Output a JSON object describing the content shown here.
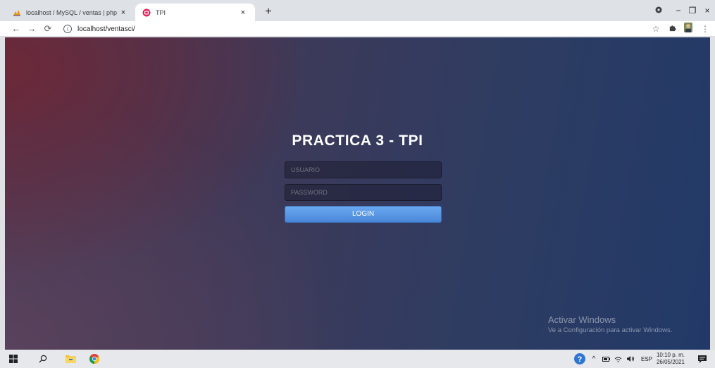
{
  "browser": {
    "tabs": [
      {
        "title": "localhost / MySQL / ventas | php",
        "active": false
      },
      {
        "title": "TPI",
        "active": true
      }
    ],
    "new_tab_label": "+",
    "close_glyph": "×",
    "url": "localhost/ventasci/",
    "window_controls": {
      "minimize": "−",
      "maximize": "❐",
      "close": "×"
    }
  },
  "page": {
    "title": "PRACTICA 3 - TPI",
    "username_placeholder": "USUARIO",
    "password_placeholder": "PASSWORD",
    "login_label": "LOGIN",
    "accent_color": "#4a86d8"
  },
  "watermark": {
    "line1": "Activar Windows",
    "line2": "Ve a Configuración para activar Windows."
  },
  "taskbar": {
    "language": "ESP",
    "time": "10:10 p. m.",
    "date": "26/05/2021",
    "icons": [
      "windows-start-icon",
      "search-icon",
      "file-explorer-icon",
      "chrome-icon",
      "help-icon",
      "chevron-up-icon",
      "battery-icon",
      "wifi-icon",
      "speaker-icon",
      "notification-icon"
    ]
  }
}
